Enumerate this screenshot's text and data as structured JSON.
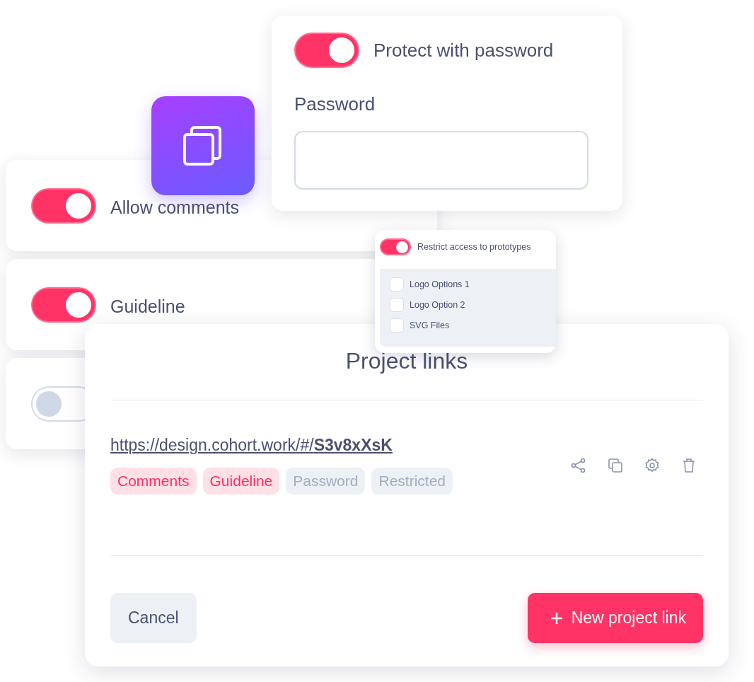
{
  "password_card": {
    "toggle": {
      "label": "Protect with password",
      "on": true
    },
    "field_label": "Password"
  },
  "toggle_cards": [
    {
      "label": "Allow comments",
      "on": true
    },
    {
      "label": "Guideline",
      "on": true
    },
    {
      "on": false
    }
  ],
  "restrict_card": {
    "toggle": {
      "label": "Restrict access to prototypes",
      "on": true
    },
    "prototypes": [
      {
        "label": "Logo Options 1",
        "checked": false
      },
      {
        "label": "Logo Option 2",
        "checked": false
      },
      {
        "label": "SVG Files",
        "checked": false
      }
    ]
  },
  "project_links": {
    "title": "Project links",
    "link": "https://design.cohort.work/#/**S3v8xXsK**",
    "tags": [
      {
        "label": "Comments",
        "on": true
      },
      {
        "label": "Guideline",
        "on": true
      },
      {
        "label": "Password",
        "on": false
      },
      {
        "label": "Restricted",
        "on": false
      }
    ],
    "buttons": [
      {
        "label": "Cancel",
        "kind": "secondary"
      },
      {
        "label": "New project link",
        "kind": "primary"
      }
    ]
  }
}
